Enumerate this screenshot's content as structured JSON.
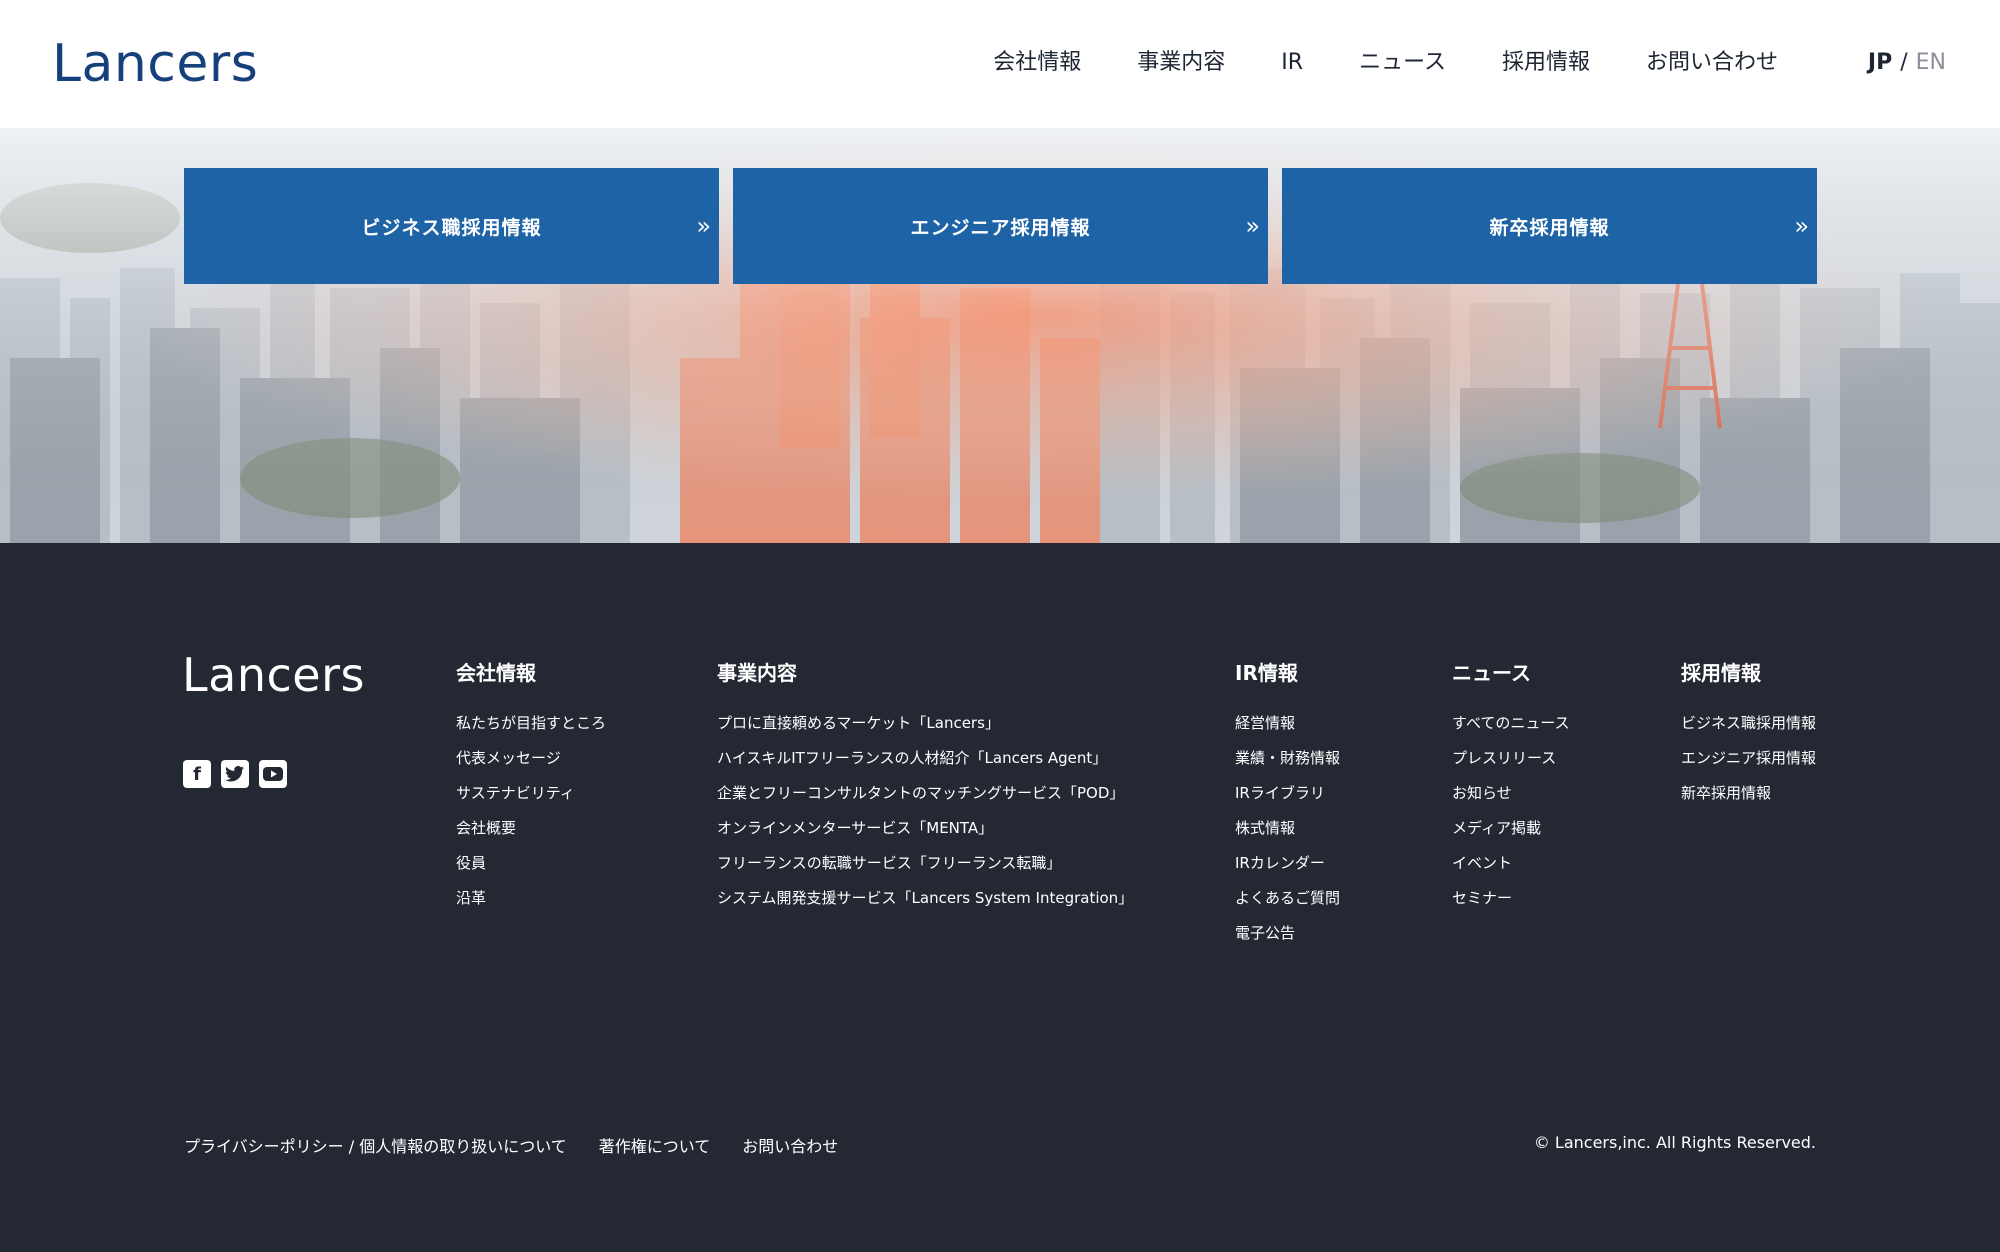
{
  "header": {
    "logo": "Lancers",
    "nav": [
      "会社情報",
      "事業内容",
      "IR",
      "ニュース",
      "採用情報",
      "お問い合わせ"
    ],
    "lang": {
      "jp": "JP",
      "sep": "/",
      "en": "EN"
    }
  },
  "hero": {
    "ctas": [
      {
        "label": "ビジネス職採用情報",
        "icon": "double-chevron-right-icon"
      },
      {
        "label": "エンジニア採用情報",
        "icon": "double-chevron-right-icon"
      },
      {
        "label": "新卒採用情報",
        "icon": "double-chevron-right-icon"
      }
    ],
    "accent": "#1e63a6"
  },
  "footer": {
    "logo": "Lancers",
    "social": [
      "facebook-icon",
      "twitter-icon",
      "youtube-icon"
    ],
    "columns": [
      {
        "title": "会社情報",
        "items": [
          "私たちが目指すところ",
          "代表メッセージ",
          "サステナビリティ",
          "会社概要",
          "役員",
          "沿革"
        ]
      },
      {
        "title": "事業内容",
        "items": [
          "プロに直接頼めるマーケット「Lancers」",
          "ハイスキルITフリーランスの人材紹介「Lancers Agent」",
          "企業とフリーコンサルタントのマッチングサービス「POD」",
          "オンラインメンターサービス「MENTA」",
          "フリーランスの転職サービス「フリーランス転職」",
          "システム開発支援サービス「Lancers System Integration」"
        ]
      },
      {
        "title": "IR情報",
        "items": [
          "経営情報",
          "業績・財務情報",
          "IRライブラリ",
          "株式情報",
          "IRカレンダー",
          "よくあるご質問",
          "電子公告"
        ]
      },
      {
        "title": "ニュース",
        "items": [
          "すべてのニュース",
          "プレスリリース",
          "お知らせ",
          "メディア掲載",
          "イベント",
          "セミナー"
        ]
      },
      {
        "title": "採用情報",
        "items": [
          "ビジネス職採用情報",
          "エンジニア採用情報",
          "新卒採用情報"
        ]
      }
    ],
    "bottom_links": [
      "プライバシーポリシー / 個人情報の取り扱いについて",
      "著作権について",
      "お問い合わせ"
    ],
    "copyright": "© Lancers,inc. All Rights Reserved.",
    "bg": "#232833"
  }
}
